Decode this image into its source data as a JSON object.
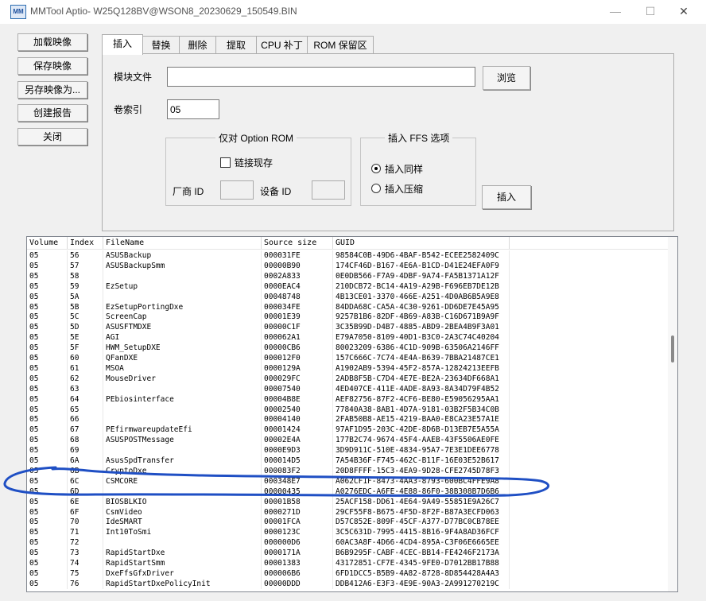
{
  "window": {
    "title": "MMTool Aptio- W25Q128BV@WSON8_20230629_150549.BIN",
    "icon_text": "MM",
    "minimize": "—",
    "maximize": "☐",
    "close": "✕"
  },
  "side_buttons": [
    "加载映像",
    "保存映像",
    "另存映像为...",
    "创建报告",
    "关闭"
  ],
  "tabs": [
    "插入",
    "替换",
    "删除",
    "提取",
    "CPU 补丁",
    "ROM 保留区"
  ],
  "insert": {
    "module_file_label": "模块文件",
    "module_file_value": "",
    "browse": "浏览",
    "volume_index_label": "卷索引",
    "volume_index_value": "05",
    "option_rom_group": "仅对 Option ROM",
    "link_existing": "链接现存",
    "vendor_id": "厂商 ID",
    "device_id": "设备 ID",
    "ffs_group": "插入 FFS 选项",
    "insert_same": "插入同样",
    "insert_compressed": "插入压缩",
    "insert_button": "插入"
  },
  "table": {
    "headers": [
      "Volume",
      "Index",
      "FileName",
      "Source size",
      "GUID"
    ],
    "rows": [
      [
        "05",
        "56",
        "ASUSBackup",
        "000031FE",
        "98584C0B-49D6-4BAF-B542-ECEE2582409C"
      ],
      [
        "05",
        "57",
        "ASUSBackupSmm",
        "00000B90",
        "174CF46D-B167-4E6A-B1CD-D41E24EFA0F9"
      ],
      [
        "05",
        "58",
        "",
        "0002A833",
        "0E0DB566-F7A9-4DBF-9A74-FA5B1371A12F"
      ],
      [
        "05",
        "59",
        "EzSetup",
        "0000EAC4",
        "210DCB72-BC14-4A19-A29B-F696EB7DE12B"
      ],
      [
        "05",
        "5A",
        "",
        "00048748",
        "4B13CE01-3370-466E-A251-4D0AB6B5A9E8"
      ],
      [
        "05",
        "5B",
        "EzSetupPortingDxe",
        "000034FE",
        "84DDA68C-CA5A-4C30-9261-DD6DE7E45A95"
      ],
      [
        "05",
        "5C",
        "ScreenCap",
        "00001E39",
        "9257B1B6-82DF-4B69-A83B-C16D671B9A9F"
      ],
      [
        "05",
        "5D",
        "ASUSFTMDXE",
        "00000C1F",
        "3C35B99D-D4B7-4885-ABD9-2BEA4B9F3A01"
      ],
      [
        "05",
        "5E",
        "AGI",
        "000062A1",
        "E79A7050-8109-40D1-B3C0-2A3C74C40204"
      ],
      [
        "05",
        "5F",
        "HWM_SetupDXE",
        "00000CB6",
        "80023209-6386-4C1D-909B-63506A2146FF"
      ],
      [
        "05",
        "60",
        "QFanDXE",
        "000012F0",
        "157C666C-7C74-4E4A-B639-7BBA21487CE1"
      ],
      [
        "05",
        "61",
        "MSOA",
        "0000129A",
        "A1902AB9-5394-45F2-857A-12824213EEFB"
      ],
      [
        "05",
        "62",
        "MouseDriver",
        "000029FC",
        "2ADB8F5B-C7D4-4E7E-BE2A-23634DF668A1"
      ],
      [
        "05",
        "63",
        "",
        "00007540",
        "4ED407CE-411E-4ADE-8A93-8A34D79F4B52"
      ],
      [
        "05",
        "64",
        "PEbiosinterface",
        "00004B8E",
        "AEF82756-87F2-4CF6-BE80-E59056295AA1"
      ],
      [
        "05",
        "65",
        "",
        "00002540",
        "77840A38-8AB1-4D7A-9181-03B2F5B34C0B"
      ],
      [
        "05",
        "66",
        "",
        "00004140",
        "2FAB50B8-AE15-4219-BAA0-E8CA23E57A1E"
      ],
      [
        "05",
        "67",
        "PEfirmwareupdateEfi",
        "00001424",
        "97AF1D95-203C-42DE-8D6B-D13EB7E5A55A"
      ],
      [
        "05",
        "68",
        "ASUSPOSTMessage",
        "00002E4A",
        "177B2C74-9674-45F4-AAEB-43F5506AE0FE"
      ],
      [
        "05",
        "69",
        "",
        "0000E9D3",
        "3D9D911C-510E-4834-95A7-7E3E1DEE6778"
      ],
      [
        "05",
        "6A",
        "AsusSpdTransfer",
        "000014D5",
        "7A54B36F-F745-462C-B11F-16E03E52B617"
      ],
      [
        "05",
        "6B",
        "CryptoDxe",
        "000083F2",
        "20D8FFFF-15C3-4EA9-9D28-CFE2745D78F3"
      ],
      [
        "05",
        "6C",
        "CSMCORE",
        "000348E7",
        "A062CF1F-8473-4AA3-8793-600BC4FFE9A8"
      ],
      [
        "05",
        "6D",
        "",
        "00000435",
        "A0276EDC-A6FE-4E88-86F0-38B308B7D6B6"
      ],
      [
        "05",
        "6E",
        "BIOSBLKIO",
        "00001B58",
        "25ACF158-DD61-4E64-9A49-55851E9A26C7"
      ],
      [
        "05",
        "6F",
        "CsmVideo",
        "0000271D",
        "29CF55F8-B675-4F5D-8F2F-B87A3ECFD063"
      ],
      [
        "05",
        "70",
        "IdeSMART",
        "00001FCA",
        "D57C852E-809F-45CF-A377-D77BC0CB78EE"
      ],
      [
        "05",
        "71",
        "Int10ToSmi",
        "0000123C",
        "3C5C631D-7995-4415-8B16-9F4A8AD36FCF"
      ],
      [
        "05",
        "72",
        "",
        "000000D6",
        "60AC3A8F-4D66-4CD4-895A-C3F06E6665EE"
      ],
      [
        "05",
        "73",
        "RapidStartDxe",
        "0000171A",
        "B6B9295F-CABF-4CEC-BB14-FE4246F2173A"
      ],
      [
        "05",
        "74",
        "RapidStartSmm",
        "00001383",
        "43172851-CF7E-4345-9FE0-D7012BB17B88"
      ],
      [
        "05",
        "75",
        "DxeFfsGfxDriver",
        "000006B6",
        "6FD1DCC5-B5B9-4A82-8728-8D854428A4A3"
      ],
      [
        "05",
        "76",
        "RapidStartDxePolicyInit",
        "00000DDD",
        "DDB412A6-E3F3-4E9E-90A3-2A991270219C"
      ]
    ]
  },
  "colors": {
    "annotation": "#1f4fc4",
    "selected_row": "#ffffff"
  }
}
